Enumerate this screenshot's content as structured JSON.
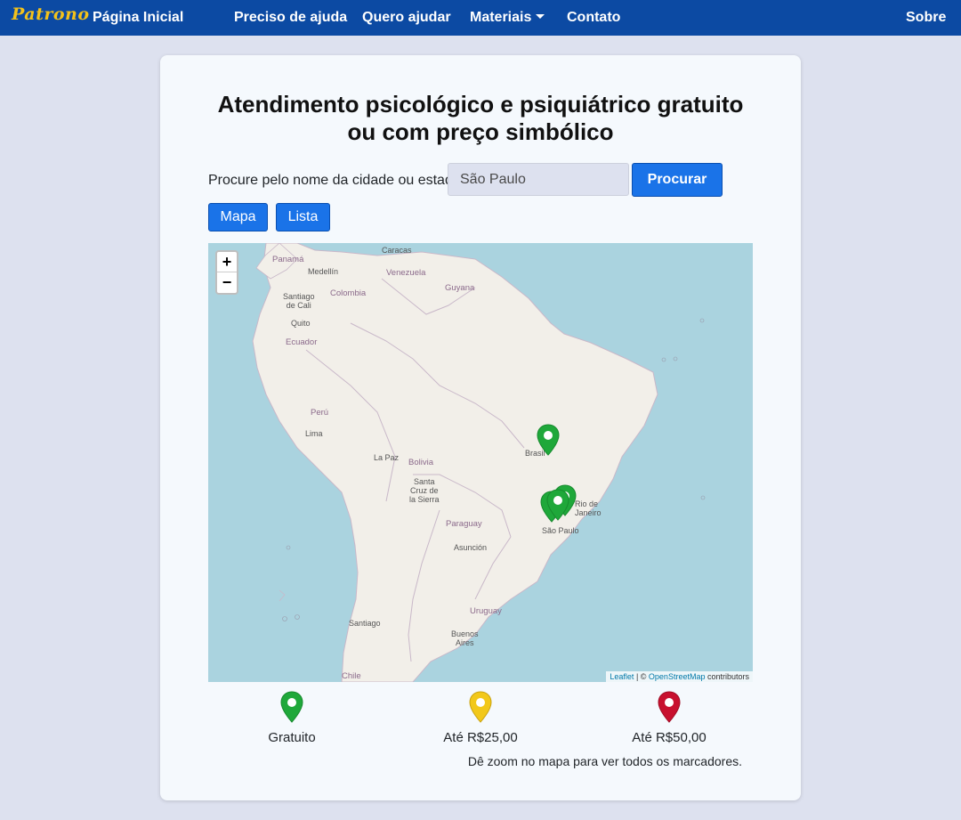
{
  "navbar": {
    "brand": "Patrono",
    "links": [
      "Página Inicial",
      "Preciso de ajuda",
      "Quero ajudar",
      "Materiais",
      "Contato"
    ],
    "about": "Sobre"
  },
  "page": {
    "title": "Atendimento psicológico e psiquiátrico gratuito ou com preço simbólico",
    "search_label": "Procure pelo nome da cidade ou estado:",
    "search_value": "São Paulo",
    "search_button": "Procurar",
    "view_map": "Mapa",
    "view_list": "Lista",
    "zoom_hint": "Dê zoom no mapa para ver todos os marcadores."
  },
  "map": {
    "zoom_in": "+",
    "zoom_out": "−",
    "attribution_leaflet": "Leaflet",
    "attribution_sep": " | © ",
    "attribution_osm": "OpenStreetMap",
    "attribution_tail": " contributors",
    "labels": {
      "panama": "Panamá",
      "caracas": "Caracas",
      "medellin": "Medellín",
      "venezuela": "Venezuela",
      "guyana": "Guyana",
      "santiago_cali": "Santiago\nde Cali",
      "colombia": "Colombia",
      "quito": "Quito",
      "ecuador": "Ecuador",
      "peru": "Perú",
      "lima": "Lima",
      "brasil": "Brasil",
      "la_paz": "La Paz",
      "bolivia": "Bolivia",
      "santa_cruz": "Santa\nCruz de\nla Sierra",
      "rio": "Rio de\nJaneiro",
      "sao_paulo": "São Paulo",
      "paraguay": "Paraguay",
      "asuncion": "Asunción",
      "uruguay": "Uruguay",
      "santiago": "Santiago",
      "buenos_aires": "Buenos\nAires",
      "chile": "Chile"
    }
  },
  "legend": [
    {
      "label": "Gratuito",
      "color": "#1fa83a"
    },
    {
      "label": "Até R$25,00",
      "color": "#f2c81a"
    },
    {
      "label": "Até R$50,00",
      "color": "#c8102e"
    }
  ],
  "colors": {
    "navbar": "#0c4aa3",
    "brand": "#f4c21a",
    "button": "#1a73e8",
    "water": "#aad3df",
    "land": "#f2efe9",
    "marker_free": "#1fa83a"
  }
}
